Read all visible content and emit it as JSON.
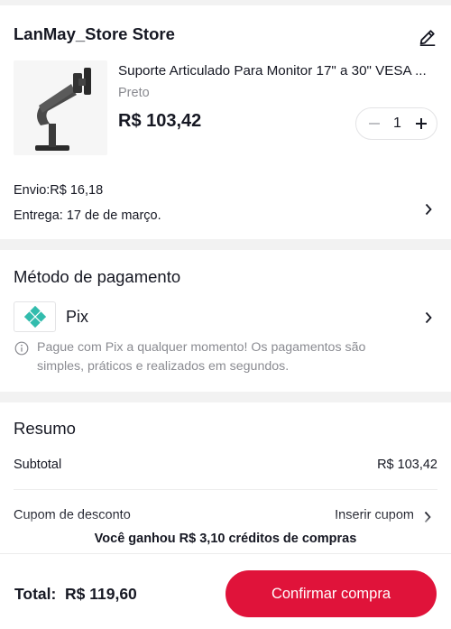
{
  "store": {
    "name": "LanMay_Store Store",
    "product": {
      "title": "Suporte Articulado Para Monitor 17\" a 30\" VESA ...",
      "variant": "Preto",
      "price": "R$ 103,42",
      "quantity": "1"
    },
    "shipping": {
      "cost": "Envio:R$ 16,18",
      "delivery": "Entrega: 17 de de março."
    }
  },
  "payment": {
    "title": "Método de pagamento",
    "method": "Pix",
    "note": "Pague com Pix a qualquer momento! Os pagamentos são simples, práticos e realizados em segundos."
  },
  "summary": {
    "title": "Resumo",
    "subtotal_label": "Subtotal",
    "subtotal_value": "R$ 103,42",
    "coupon_label": "Cupom de desconto",
    "coupon_action": "Inserir cupom"
  },
  "credit_banner": "Você ganhou R$ 3,10 créditos de compras",
  "footer": {
    "total_label": "Total:",
    "total_value": "R$ 119,60",
    "confirm_label": "Confirmar compra"
  },
  "colors": {
    "accent": "#e0133a",
    "pix": "#32bcad",
    "muted_text": "#8a8b91"
  }
}
